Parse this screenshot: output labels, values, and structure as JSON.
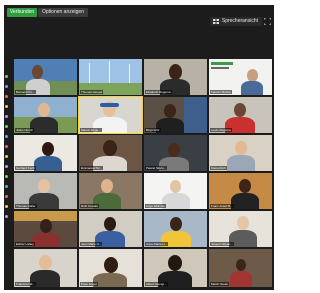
{
  "window": {
    "status_badge": "Verbunden",
    "tab_label": "Optionen anzeigen",
    "view_button": "Sprecheransicht",
    "accent_color": "#2e9e3e"
  },
  "participants": [
    {
      "name": "Bernard Fro..."
    },
    {
      "name": "Thomas Hengel"
    },
    {
      "name": "Elisabeth Rugema"
    },
    {
      "name": "Faustin Muhuk"
    },
    {
      "name": "Julius Hirsch"
    },
    {
      "name": "Marcel Ishgu..."
    },
    {
      "name": "Birgit Fritz"
    },
    {
      "name": "Lewis Rugema"
    },
    {
      "name": "Gerhard Koch"
    },
    {
      "name": "Emmanuel Nc..."
    },
    {
      "name": "Pascal Nkulu..."
    },
    {
      "name": "Kasia Ruth"
    },
    {
      "name": "Thomas Deller"
    },
    {
      "name": "Ruth Kessler"
    },
    {
      "name": "Ange Ishimwe"
    },
    {
      "name": "Franz-Josef M..."
    },
    {
      "name": "Esther Lahey"
    },
    {
      "name": "Jean Marie U..."
    },
    {
      "name": "Anne-Marie H..."
    },
    {
      "name": "Joseph Ndyan..."
    },
    {
      "name": "Francine Nd..."
    },
    {
      "name": "Peter Engel"
    },
    {
      "name": "Albert Nsengi..."
    },
    {
      "name": "Martin Sauer"
    },
    {
      "name": "Claudine Nyir..."
    },
    {
      "name": "Paul Grosser"
    },
    {
      "name": "Emmanuel Rugira"
    },
    {
      "name": "Samuel Kabera"
    },
    {
      "name": "Ludwigs Ruhumuriza"
    },
    {
      "name": "Ludwig Bauer"
    }
  ]
}
